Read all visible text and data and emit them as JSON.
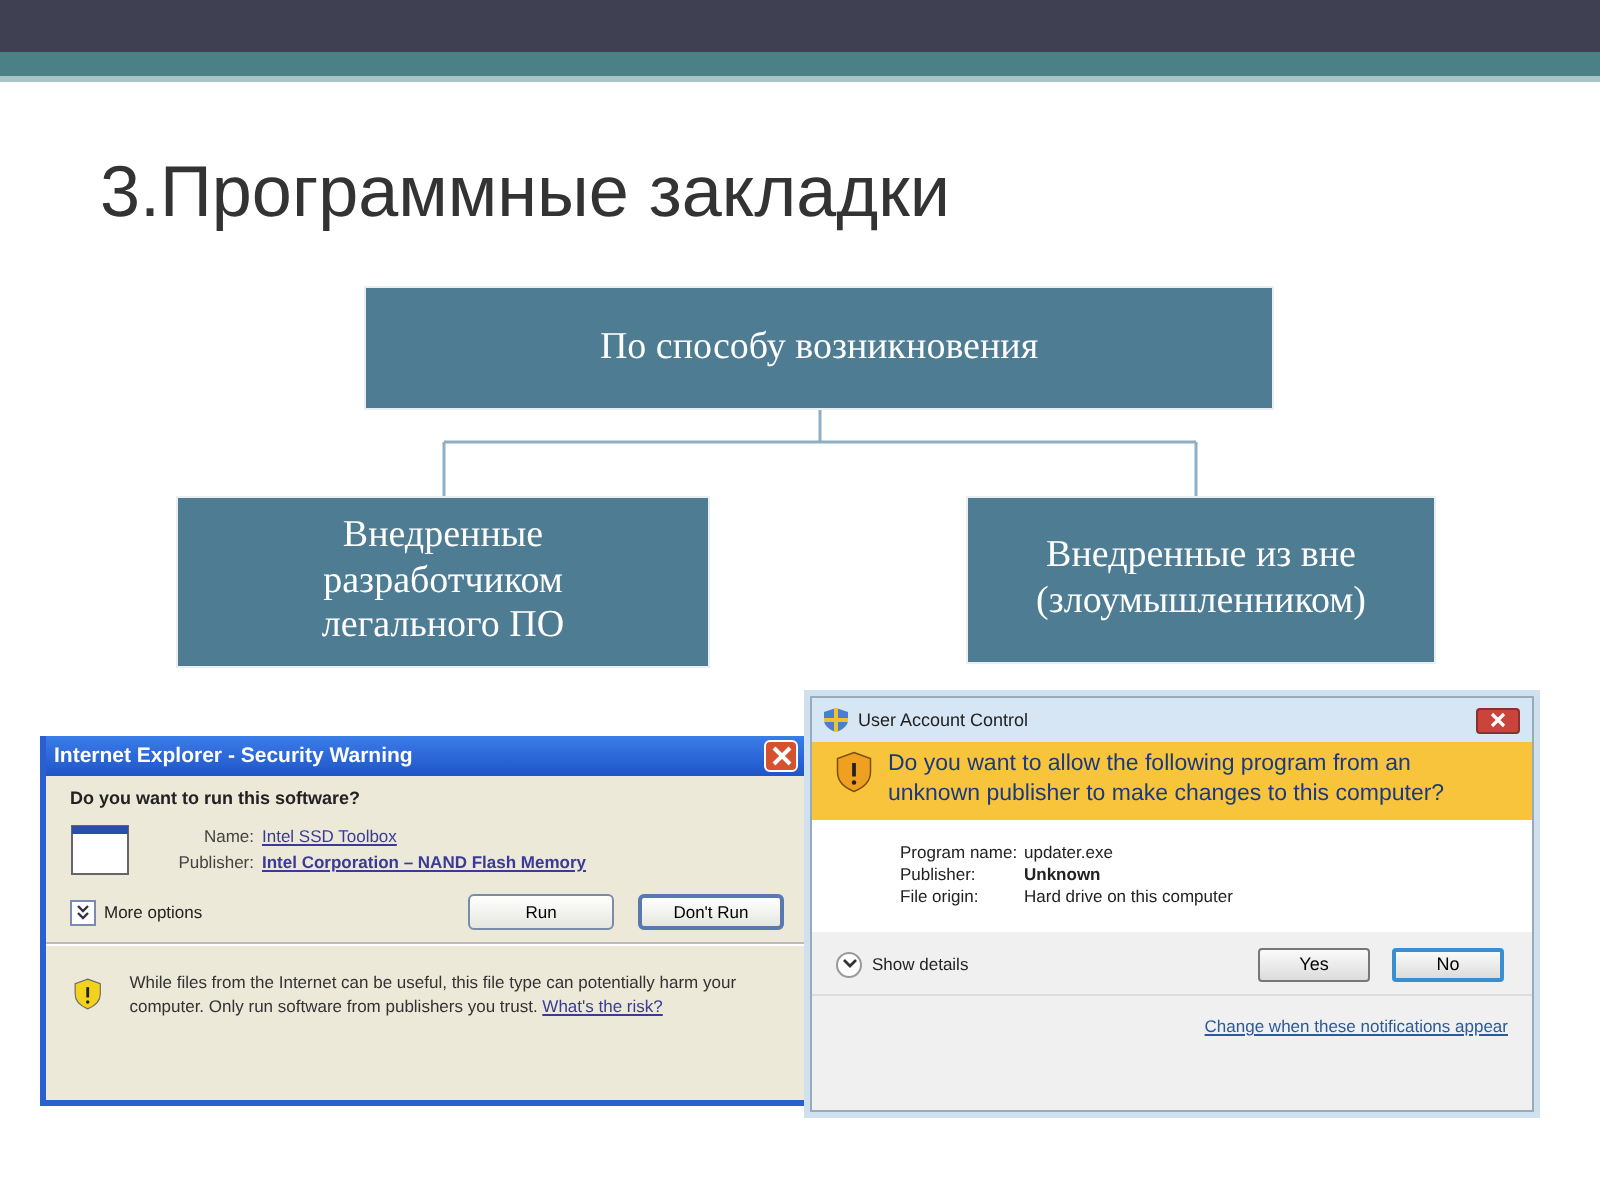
{
  "title": "3.Программные закладки",
  "diagram": {
    "root": "По способу возникновения",
    "children": [
      {
        "label": "Внедренные разработчиком легального ПО"
      },
      {
        "label": "Внедренные из вне (злоумышленником)"
      }
    ]
  },
  "security_warning": {
    "title": "Internet Explorer - Security Warning",
    "question": "Do you want to run this software?",
    "fields": [
      {
        "label": "Name:",
        "value": "Intel SSD Toolbox",
        "bold": false
      },
      {
        "label": "Publisher:",
        "value": "Intel Corporation – NAND Flash Memory",
        "bold": true
      }
    ],
    "more_options": "More options",
    "buttons": [
      {
        "label": "Run",
        "default": false
      },
      {
        "label": "Don't Run",
        "default": true
      }
    ],
    "warning_text": "While files from the Internet can be useful, this file type can potentially harm your computer. Only run software from publishers you trust.",
    "risk_link": "What's the risk?"
  },
  "uac": {
    "title": "User Account Control",
    "question": "Do you want to allow the following program from an unknown publisher to make changes to this computer?",
    "fields": [
      {
        "label": "Program name:",
        "value": "updater.exe",
        "bold": false
      },
      {
        "label": "Publisher:",
        "value": "Unknown",
        "bold": true
      },
      {
        "label": "File origin:",
        "value": "Hard drive on this computer",
        "bold": false
      }
    ],
    "show_details": "Show details",
    "buttons": [
      {
        "label": "Yes",
        "default": false
      },
      {
        "label": "No",
        "default": true
      }
    ],
    "link": "Change when these notifications appear"
  }
}
